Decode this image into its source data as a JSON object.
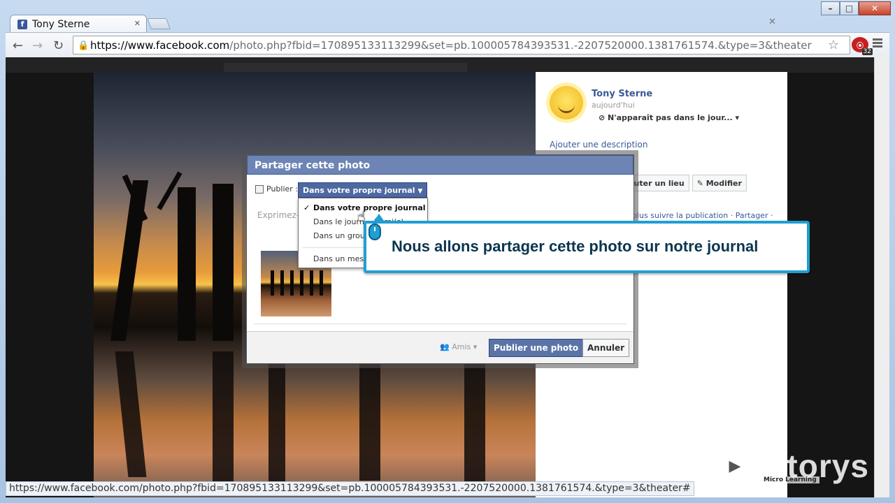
{
  "browser": {
    "tab_title": "Tony Sterne",
    "tab_icon": "facebook-icon",
    "url_host": "https://www.facebook.com",
    "url_rest": "/photo.php?fbid=170895133113299&set=pb.100005784393531.-2207520000.1381761574.&type=3&theater",
    "extension_badge": "32",
    "status_url": "https://www.facebook.com/photo.php?fbid=170895133113299&set=pb.100005784393531.-2207520000.1381761574.&type=3&theater#"
  },
  "side": {
    "name": "Tony Sterne",
    "time": "aujourd'hui",
    "visibility": "N'apparaît pas dans le jour...",
    "add_description": "Ajouter une description",
    "btn_location": "outer un lieu",
    "btn_edit": "Modifier",
    "follow": "plus suivre la publication · Partager ·"
  },
  "dialog": {
    "title": "Partager cette photo",
    "publish_label": "Publier :",
    "selected": "Dans votre propre journal",
    "placeholder": "Exprimez-",
    "privacy": "Amis",
    "publish_button": "Publier une photo",
    "cancel_button": "Annuler"
  },
  "dropdown": {
    "items": [
      "Dans votre propre journal",
      "Dans le journ... ) ami(s)",
      "Dans un groupe",
      "Dans un messa"
    ]
  },
  "callout": {
    "text": "Nous allons partager cette photo sur notre journal"
  },
  "watermark": {
    "brand": "tutorys",
    "sub": "Micro Learning"
  },
  "colors": {
    "fb_blue": "#3b5998",
    "callout_border": "#1f9fd3"
  }
}
